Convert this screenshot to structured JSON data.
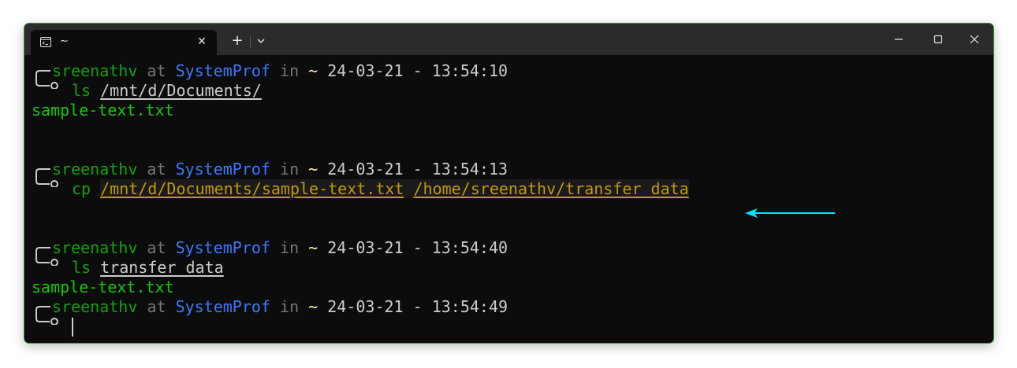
{
  "window": {
    "tab_title": "~",
    "tab_close": "✕",
    "new_tab": "+",
    "accent_border": "#3f8f3f",
    "background": "#0c0c0c"
  },
  "prompts": [
    {
      "user": "sreenathv",
      "at": "at",
      "host": "SystemProf",
      "in": "in",
      "dir": "~",
      "time": "24-03-21 - 13:54:10",
      "command": "ls",
      "args": [
        "/mnt/d/Documents/"
      ],
      "output": "sample-text.txt"
    },
    {
      "user": "sreenathv",
      "at": "at",
      "host": "SystemProf",
      "in": "in",
      "dir": "~",
      "time": "24-03-21 - 13:54:13",
      "command": "cp",
      "args": [
        "/mnt/d/Documents/sample-text.txt",
        "/home/sreenathv/transfer_data"
      ],
      "output": ""
    },
    {
      "user": "sreenathv",
      "at": "at",
      "host": "SystemProf",
      "in": "in",
      "dir": "~",
      "time": "24-03-21 - 13:54:40",
      "command": "ls",
      "args": [
        "transfer_data"
      ],
      "output": "sample-text.txt"
    },
    {
      "user": "sreenathv",
      "at": "at",
      "host": "SystemProf",
      "in": "in",
      "dir": "~",
      "time": "24-03-21 - 13:54:49",
      "command": "",
      "args": [],
      "output": ""
    }
  ],
  "colors": {
    "user": "#13a10e",
    "host": "#3b78ff",
    "muted": "#767676",
    "dir": "#f9f1a5",
    "output": "#16c60c",
    "highlight_args": "#c19c00",
    "arrow": "#00e5ff"
  },
  "icons": {
    "tab_icon": "terminal-icon",
    "minimize": "minimize-icon",
    "maximize": "maximize-icon",
    "close": "close-icon",
    "dropdown": "chevron-down-icon",
    "annotation": "arrow-left-icon"
  }
}
